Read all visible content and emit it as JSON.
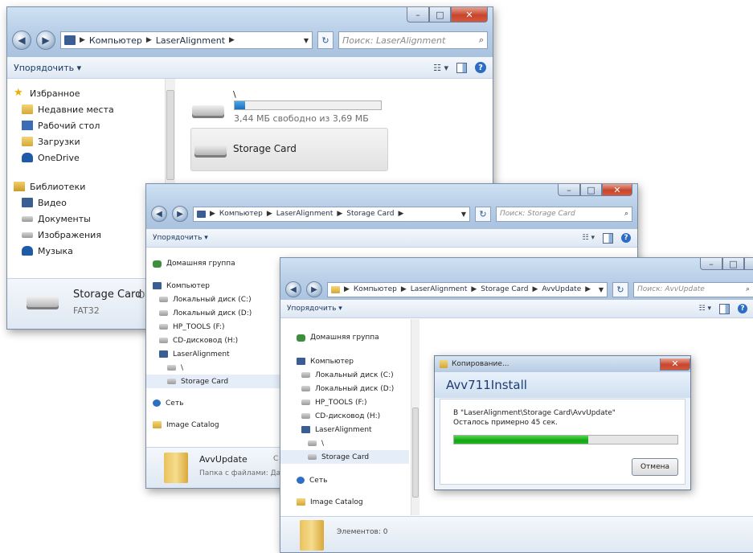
{
  "window1": {
    "breadcrumb": [
      "Компьютер",
      "LaserAlignment"
    ],
    "search_placeholder": "Поиск: LaserAlignment",
    "toolbar_organize": "Упорядочить ▾",
    "nav": {
      "favorites": "Избранное",
      "recent": "Недавние места",
      "desktop": "Рабочий стол",
      "downloads": "Загрузки",
      "onedrive": "OneDrive",
      "libraries": "Библиотеки",
      "video": "Видео",
      "documents": "Документы",
      "images": "Изображения",
      "music": "Музыка"
    },
    "drive_root": {
      "name": "\\",
      "free_text": "3,44 МБ свободно из 3,69 МБ",
      "used_fraction": 0.07
    },
    "storage_card": "Storage Card",
    "status_name": "Storage Card",
    "status_o": "О",
    "status_fs": "FAT32"
  },
  "window2": {
    "breadcrumb": [
      "Компьютер",
      "LaserAlignment",
      "Storage Card"
    ],
    "search_placeholder": "Поиск: Storage Card",
    "toolbar_organize": "Упорядочить ▾",
    "nav": {
      "homegroup": "Домашняя группа",
      "computer": "Компьютер",
      "drive_c": "Локальный диск (C:)",
      "drive_d": "Локальный диск (D:)",
      "hp_tools": "HP_TOOLS (F:)",
      "cd_drive": "CD-дисковод (H:)",
      "laser": "LaserAlignment",
      "root": "\\",
      "storage_card": "Storage Card",
      "network": "Сеть",
      "image_catalog": "Image Catalog"
    },
    "status_name": "AvvUpdate",
    "status_c": "С",
    "status_sub": "Папка с файлами: Да"
  },
  "window3": {
    "breadcrumb": [
      "Компьютер",
      "LaserAlignment",
      "Storage Card",
      "AvvUpdate"
    ],
    "search_placeholder": "Поиск: AvvUpdate",
    "toolbar_organize": "Упорядочить ▾",
    "nav": {
      "homegroup": "Домашняя группа",
      "computer": "Компьютер",
      "drive_c": "Локальный диск (C:)",
      "drive_d": "Локальный диск (D:)",
      "hp_tools": "HP_TOOLS (F:)",
      "cd_drive": "CD-дисковод (H:)",
      "laser": "LaserAlignment",
      "root": "\\",
      "storage_card": "Storage Card",
      "network": "Сеть",
      "image_catalog": "Image Catalog"
    },
    "status_text": "Элементов: 0"
  },
  "copy_dialog": {
    "title": "Копирование...",
    "file": "Avv711Install",
    "destination": "В \"LaserAlignment\\Storage Card\\AvvUpdate\"",
    "remaining": "Осталось примерно 45 сек.",
    "progress_fraction": 0.6,
    "cancel": "Отмена",
    "colors": {
      "progress": "#14a514",
      "close": "#c7452d"
    }
  }
}
